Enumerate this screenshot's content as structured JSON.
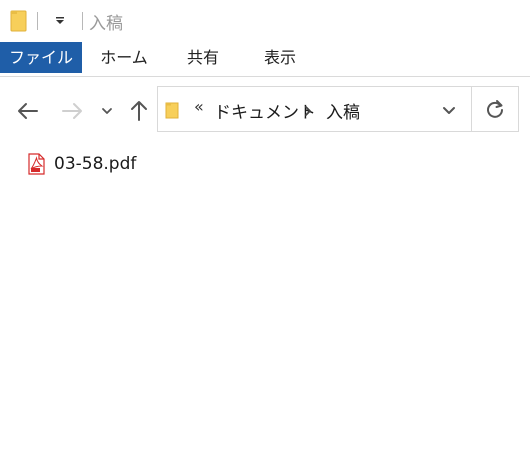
{
  "window": {
    "title": "入稿"
  },
  "ribbon": {
    "tabs": [
      {
        "label": "ファイル",
        "active": true
      },
      {
        "label": "ホーム"
      },
      {
        "label": "共有"
      },
      {
        "label": "表示"
      }
    ]
  },
  "navigation": {
    "overflow_glyph": "«",
    "breadcrumb": [
      "ドキュメント",
      "入稿"
    ]
  },
  "files": [
    {
      "name": "03-58.pdf",
      "icon": "pdf-file-icon"
    }
  ],
  "colors": {
    "file_tab_background": "#1f5ea8",
    "folder_yellow": "#f7cf5a",
    "pdf_red": "#d62b2b"
  }
}
